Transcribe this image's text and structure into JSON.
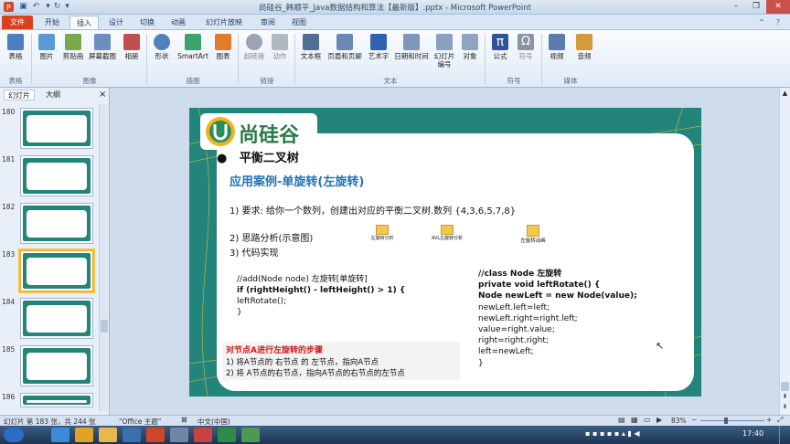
{
  "window": {
    "title": "尚硅谷_韩顺平_Java数据结构和算法【最新版】.pptx - Microsoft PowerPoint",
    "controls": [
      "–",
      "❐",
      "✕"
    ]
  },
  "tabs": [
    {
      "label": "文件"
    },
    {
      "label": "开始"
    },
    {
      "label": "插入"
    },
    {
      "label": "设计"
    },
    {
      "label": "切换"
    },
    {
      "label": "动画"
    },
    {
      "label": "幻灯片放映"
    },
    {
      "label": "审阅"
    },
    {
      "label": "视图"
    }
  ],
  "ribbon": {
    "buttons": [
      {
        "label": "表格",
        "color": "#4a7fc1"
      },
      {
        "label": "图片",
        "color": "#5b9bd5"
      },
      {
        "label": "剪贴画",
        "color": "#7aa84b"
      },
      {
        "label": "屏幕截图",
        "color": "#6d8fbf"
      },
      {
        "label": "相册",
        "color": "#c0504d"
      },
      {
        "label": "形状",
        "color": "#4f81bd"
      },
      {
        "label": "SmartArt",
        "color": "#3ea36b"
      },
      {
        "label": "图表",
        "color": "#e37b2c"
      },
      {
        "label": "超链接",
        "color": "#9aa5b1"
      },
      {
        "label": "动作",
        "color": "#b0b8c2"
      },
      {
        "label": "文本框",
        "color": "#4f6e96"
      },
      {
        "label": "页眉和页脚",
        "color": "#6a88b4"
      },
      {
        "label": "艺术字",
        "color": "#2f63b2"
      },
      {
        "label": "日期和时间",
        "color": "#7e97ba"
      },
      {
        "label": "幻灯片\n编号",
        "color": "#8aa0c0"
      },
      {
        "label": "对象",
        "color": "#90a4c0"
      },
      {
        "label": "公式",
        "color": "#2f5597"
      },
      {
        "label": "符号",
        "color": "#8a95a3"
      },
      {
        "label": "视频",
        "color": "#5d7bab"
      },
      {
        "label": "音频",
        "color": "#d59a3a"
      }
    ],
    "groups": [
      "表格",
      "图像",
      "插图",
      "链接",
      "文本",
      "符号",
      "媒体"
    ]
  },
  "leftpane": {
    "tabs": [
      "幻灯片",
      "大纲"
    ],
    "close": "×",
    "slide_numbers": [
      "180",
      "181",
      "182",
      "183",
      "184",
      "185",
      "186"
    ],
    "selected_index": 3
  },
  "slide": {
    "logo_text": "尚硅谷",
    "bullet_title": "平衡二叉树",
    "subtitle": "应用案例-单旋转(左旋转)",
    "req": "1)   要求: 给你一个数列，创建出对应的平衡二叉树.数列 {4,3,6,5,7,8}",
    "step2": "2)   思路分析(示意图)",
    "step3": "3)   代码实现",
    "folders": [
      {
        "label": "左旋转分析"
      },
      {
        "label": "AVL左旋转分析"
      },
      {
        "label": "左旋转动画"
      }
    ],
    "code_left": [
      "//add(Node node) 左旋转[单旋转]",
      "if (rightHeight() - leftHeight() > 1) {",
      "leftRotate();",
      "}"
    ],
    "code_right": [
      "//class Node 左旋转",
      "private void leftRotate() {",
      "Node newLeft = new Node(value);",
      "newLeft.left=left;",
      "newLeft.right=right.left;",
      "value=right.value;",
      "right=right.right;",
      "left=newLeft;",
      "}"
    ],
    "steps_title": "对节点A进行左旋转的步骤",
    "steps": [
      "1)     将A节点的 右节点 的 左节点，指向A节点",
      "2)     将 A节点的右节点，指向A节点的右节点的左节点"
    ]
  },
  "status": {
    "slide_info": "幻灯片 第 183 张，共 244 张",
    "theme": "\"Office 主题\"",
    "language": "中文(中国)",
    "zoom": "83%"
  },
  "taskbar": {
    "clock": "17:40",
    "apps": [
      {
        "icon": "windows-start",
        "color": "#2b6cc4"
      },
      {
        "icon": "ie",
        "color": "#3c8bd9"
      },
      {
        "icon": "chrome",
        "color": "#e0a325"
      },
      {
        "icon": "folder",
        "color": "#e8b84a"
      },
      {
        "icon": "media",
        "color": "#3a6fb0"
      },
      {
        "icon": "powerpoint",
        "color": "#d04525"
      },
      {
        "icon": "app-clock",
        "color": "#6f86a6"
      },
      {
        "icon": "app-pdf",
        "color": "#c94141"
      },
      {
        "icon": "excel",
        "color": "#2f8a47"
      },
      {
        "icon": "camtasia",
        "color": "#4a9a52"
      }
    ]
  }
}
